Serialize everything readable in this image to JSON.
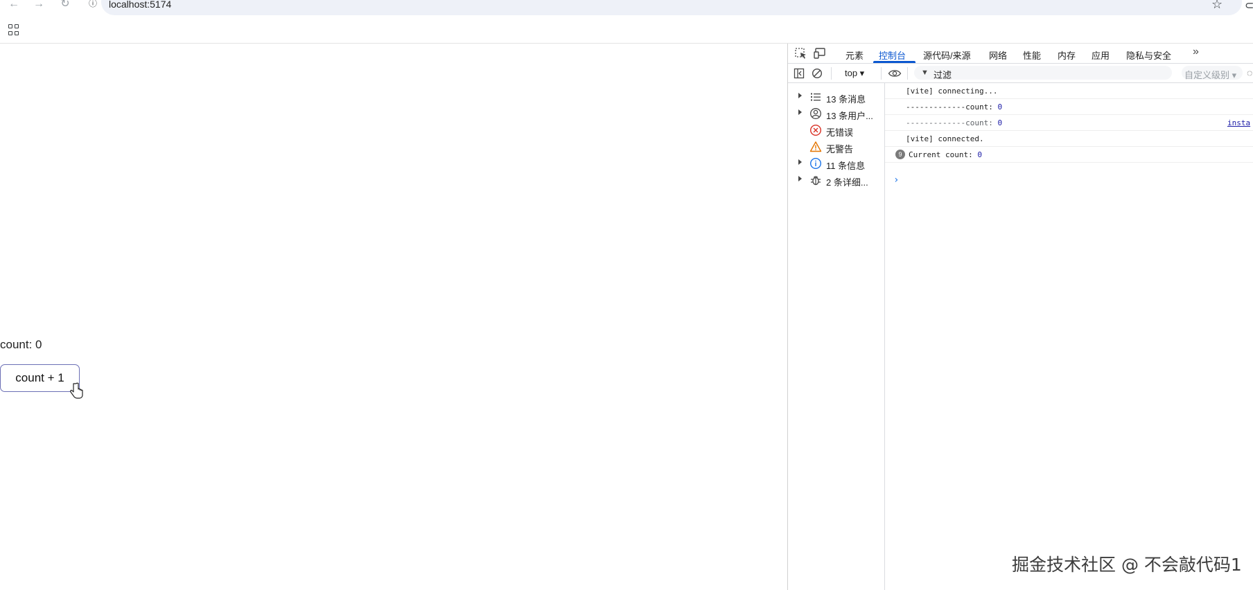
{
  "browser": {
    "url": "localhost:5174",
    "nav_icons": [
      "back-icon",
      "forward-icon",
      "reload-icon"
    ]
  },
  "page": {
    "count_text": "count: 0",
    "button_label": "count + 1"
  },
  "devtools": {
    "tabs": [
      "元素",
      "控制台",
      "源代码/来源",
      "网络",
      "性能",
      "内存",
      "应用",
      "隐私与安全"
    ],
    "active_tab": "控制台",
    "more_tabs": "»",
    "context": "top ▾",
    "filter_placeholder": "过滤",
    "levels": "自定义级别 ▾",
    "sidebar": [
      {
        "label": "13 条消息",
        "icon": "list-icon",
        "expandable": true
      },
      {
        "label": "13 条用户...",
        "icon": "user-icon",
        "expandable": true
      },
      {
        "label": "无错误",
        "icon": "error-icon",
        "expandable": false
      },
      {
        "label": "无警告",
        "icon": "warning-icon",
        "expandable": false
      },
      {
        "label": "11 条信息",
        "icon": "info-icon",
        "expandable": true
      },
      {
        "label": "2 条详细...",
        "icon": "bug-icon",
        "expandable": true
      }
    ],
    "logs": [
      {
        "text": "[vite] connecting...",
        "value": "",
        "dim": false
      },
      {
        "text": "-------------count: ",
        "value": "0",
        "dim": false
      },
      {
        "text": "-------------count: ",
        "value": "0",
        "dim": true,
        "source": "insta"
      },
      {
        "text": "[vite] connected.",
        "value": "",
        "dim": false
      },
      {
        "text": "Current count: ",
        "value": "0",
        "dim": false,
        "repeat": "9"
      }
    ],
    "prompt": "›"
  },
  "watermark": "掘金技术社区 @ 不会敲代码1",
  "colors": {
    "accent": "#0b57d0",
    "button_border": "#6b6fb5",
    "error": "#d93025",
    "warning": "#e37400",
    "info": "#1a73e8"
  }
}
